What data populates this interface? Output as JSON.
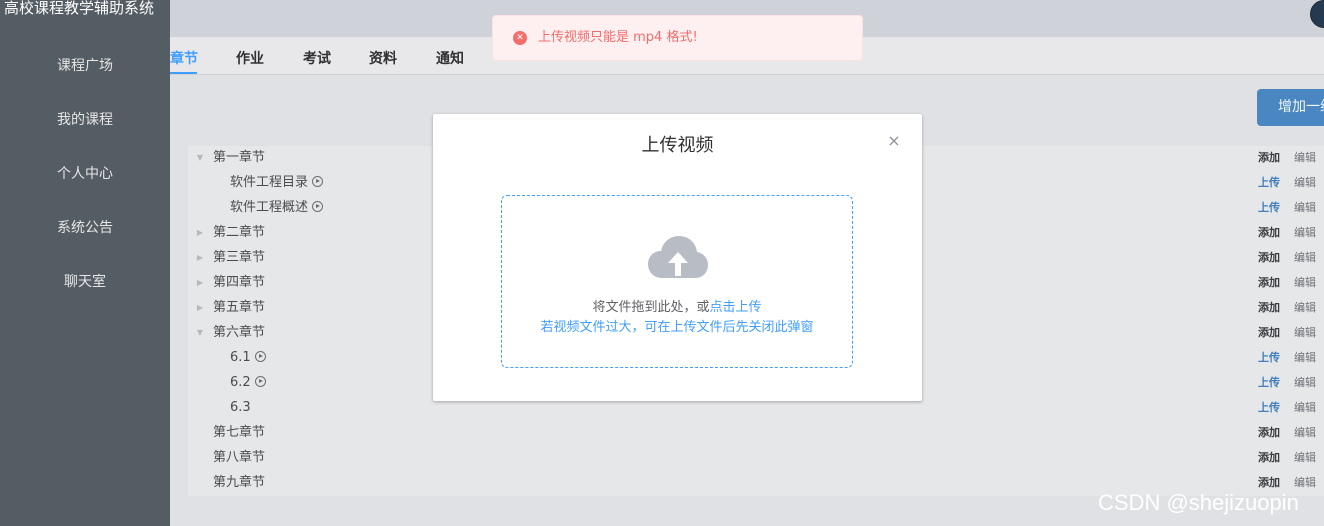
{
  "app": {
    "title": "高校课程教学辅助系统"
  },
  "sidebar": {
    "items": [
      {
        "label": "课程广场"
      },
      {
        "label": "我的课程"
      },
      {
        "label": "个人中心"
      },
      {
        "label": "系统公告"
      },
      {
        "label": "聊天室"
      }
    ]
  },
  "tabs": [
    {
      "label": "章节",
      "active": true
    },
    {
      "label": "作业",
      "active": false
    },
    {
      "label": "考试",
      "active": false
    },
    {
      "label": "资料",
      "active": false
    },
    {
      "label": "通知",
      "active": false
    }
  ],
  "toolbar": {
    "add_chapter_label": "增加一组"
  },
  "tree": {
    "rows": [
      {
        "label": "第一章节",
        "level": 0,
        "arrow": "expanded",
        "video": false,
        "action": "添加",
        "edit": "编辑"
      },
      {
        "label": "软件工程目录",
        "level": 1,
        "arrow": "none",
        "video": true,
        "action": "上传",
        "edit": "编辑"
      },
      {
        "label": "软件工程概述",
        "level": 1,
        "arrow": "none",
        "video": true,
        "action": "上传",
        "edit": "编辑"
      },
      {
        "label": "第二章节",
        "level": 0,
        "arrow": "collapsed",
        "video": false,
        "action": "添加",
        "edit": "编辑"
      },
      {
        "label": "第三章节",
        "level": 0,
        "arrow": "collapsed",
        "video": false,
        "action": "添加",
        "edit": "编辑"
      },
      {
        "label": "第四章节",
        "level": 0,
        "arrow": "collapsed",
        "video": false,
        "action": "添加",
        "edit": "编辑"
      },
      {
        "label": "第五章节",
        "level": 0,
        "arrow": "collapsed",
        "video": false,
        "action": "添加",
        "edit": "编辑"
      },
      {
        "label": "第六章节",
        "level": 0,
        "arrow": "expanded",
        "video": false,
        "action": "添加",
        "edit": "编辑"
      },
      {
        "label": "6.1",
        "level": 1,
        "arrow": "none",
        "video": true,
        "action": "上传",
        "edit": "编辑"
      },
      {
        "label": "6.2",
        "level": 1,
        "arrow": "none",
        "video": true,
        "action": "上传",
        "edit": "编辑"
      },
      {
        "label": "6.3",
        "level": 1,
        "arrow": "none",
        "video": false,
        "action": "上传",
        "edit": "编辑"
      },
      {
        "label": "第七章节",
        "level": 0,
        "arrow": "none",
        "video": false,
        "action": "添加",
        "edit": "编辑"
      },
      {
        "label": "第八章节",
        "level": 0,
        "arrow": "none",
        "video": false,
        "action": "添加",
        "edit": "编辑"
      },
      {
        "label": "第九章节",
        "level": 0,
        "arrow": "none",
        "video": false,
        "action": "添加",
        "edit": "编辑"
      }
    ]
  },
  "modal": {
    "title": "上传视频",
    "close_icon": "close-icon",
    "upload_icon": "cloud-upload-icon",
    "drop_text": "将文件拖到此处，或",
    "click_upload": "点击上传",
    "tip": "若视频文件过大，可在上传文件后先关闭此弹窗"
  },
  "toast": {
    "icon": "error-circle-icon",
    "message": "上传视频只能是 mp4 格式!"
  },
  "watermark": "CSDN @shejizuopin",
  "colors": {
    "sidebar": "#545c64",
    "accent": "#409eff",
    "error": "#f56c6c",
    "error_bg": "#fef0f0"
  }
}
